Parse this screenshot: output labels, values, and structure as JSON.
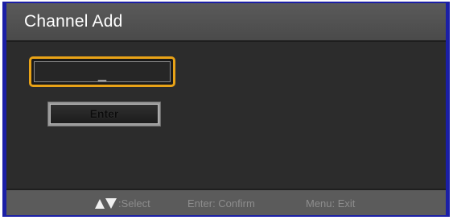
{
  "window": {
    "title": "Channel Add"
  },
  "channel_input": {
    "value": "_"
  },
  "enter_button": {
    "label": "Enter"
  },
  "footer": {
    "select_icons": [
      "arrow-up-icon",
      "arrow-down-icon"
    ],
    "select_label": ":Select",
    "confirm_label": "Enter: Confirm",
    "exit_label": "Menu: Exit"
  },
  "colors": {
    "frame_border": "#1b1fa6",
    "focus_outline": "#e9a317",
    "background": "#2c2c2c",
    "footer_background": "#5b5b5b"
  }
}
